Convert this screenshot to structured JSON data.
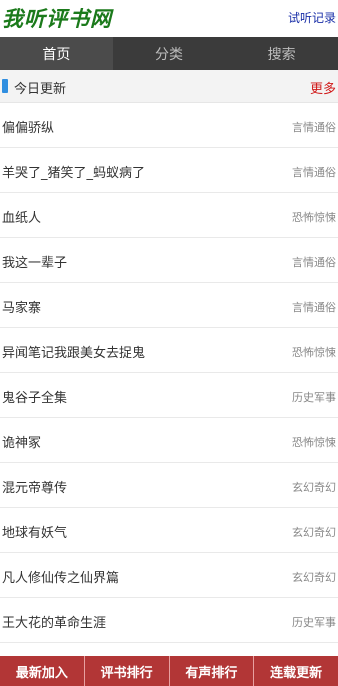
{
  "header": {
    "logo": "我听评书网",
    "history": "试听记录"
  },
  "nav": {
    "tabs": [
      {
        "label": "首页"
      },
      {
        "label": "分类"
      },
      {
        "label": "搜索"
      }
    ]
  },
  "section": {
    "title": "今日更新",
    "more": "更多"
  },
  "items": [
    {
      "title": "偏偏骄纵",
      "category": "言情通俗"
    },
    {
      "title": "羊哭了_猪笑了_蚂蚁病了",
      "category": "言情通俗"
    },
    {
      "title": "血纸人",
      "category": "恐怖惊悚"
    },
    {
      "title": "我这一辈子",
      "category": "言情通俗"
    },
    {
      "title": "马家寨",
      "category": "言情通俗"
    },
    {
      "title": "异闻笔记我跟美女去捉鬼",
      "category": "恐怖惊悚"
    },
    {
      "title": "鬼谷子全集",
      "category": "历史军事"
    },
    {
      "title": "诡神冢",
      "category": "恐怖惊悚"
    },
    {
      "title": "混元帝尊传",
      "category": "玄幻奇幻"
    },
    {
      "title": "地球有妖气",
      "category": "玄幻奇幻"
    },
    {
      "title": "凡人修仙传之仙界篇",
      "category": "玄幻奇幻"
    },
    {
      "title": "王大花的革命生涯",
      "category": "历史军事"
    }
  ],
  "bottom": {
    "buttons": [
      {
        "label": "最新加入"
      },
      {
        "label": "评书排行"
      },
      {
        "label": "有声排行"
      },
      {
        "label": "连载更新"
      }
    ]
  },
  "colors": {
    "logo": "#1b7a1b",
    "nav_bg": "#3b3b3b",
    "accent_bar": "#2f8ee0",
    "more": "#d01818",
    "bottom_btn": "#b23636"
  }
}
